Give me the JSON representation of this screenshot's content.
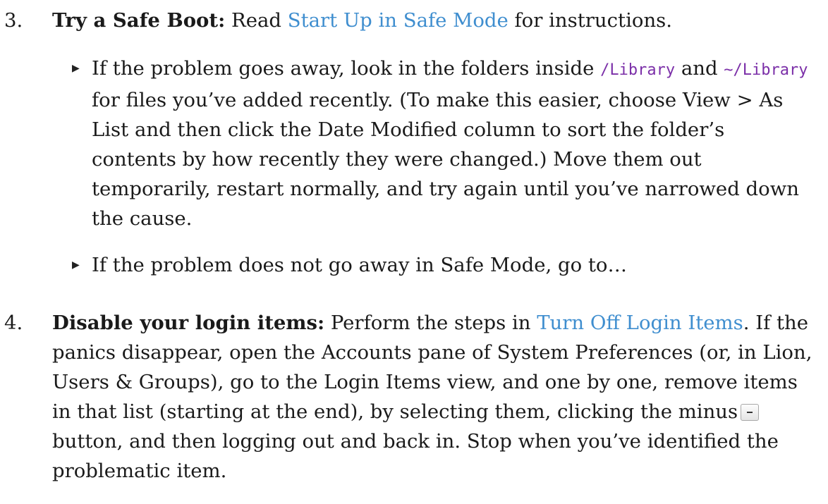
{
  "step3": {
    "number": "3.",
    "lead": "Try a Safe Boot:",
    "text_before_link": " Read ",
    "link": "Start Up in Safe Mode",
    "text_after_link": " for instructions.",
    "bullets": [
      {
        "t1": "If the problem goes away, look in the folders inside ",
        "code1": "/Library",
        "t2": " and ",
        "code2": "~/Library",
        "t3": " for files you’ve added recently. (To make this easier, choose View > As List and then click the Date Modified column to sort the folder’s contents by how recently they were changed.) Move them out temporarily, restart normally, and try again until you’ve narrowed down the cause."
      },
      {
        "t1": "If the problem does not go away in Safe Mode, go to…"
      }
    ]
  },
  "step4": {
    "number": "4.",
    "lead": "Disable your login items:",
    "text_before_link": " Perform the steps in ",
    "link": "Turn Off Login Items",
    "text_after_link": ". If the panics disappear, open the Accounts pane of System Preferences (or, in Lion, Users & Groups), go to the Login Items view, and one by one, remove items in that list (starting at the end), by selecting them, clicking the minus",
    "text_after_button": "button, and then logging out and back in. Stop when you’ve identified the problematic item.",
    "minus_button_icon": "minus-icon"
  },
  "colors": {
    "link": "#3f8ecf",
    "code": "#7b2fa8",
    "text": "#1a1a1a"
  }
}
